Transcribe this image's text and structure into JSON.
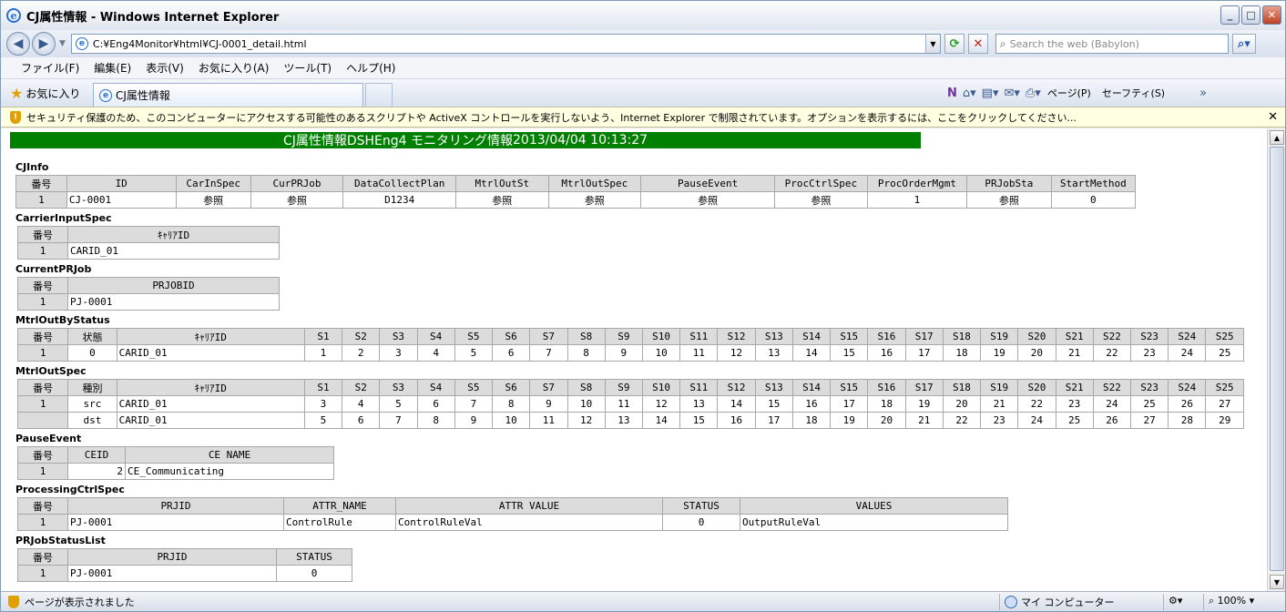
{
  "window": {
    "title": "CJ属性情報 - Windows Internet Explorer"
  },
  "address": {
    "url": "C:¥Eng4Monitor¥html¥CJ-0001_detail.html",
    "search_placeholder": "Search the web (Babylon)"
  },
  "menu": [
    "ファイル(F)",
    "編集(E)",
    "表示(V)",
    "お気に入り(A)",
    "ツール(T)",
    "ヘルプ(H)"
  ],
  "favorites": {
    "label": "お気に入り",
    "tab_title": "CJ属性情報"
  },
  "commands": {
    "page": "ページ(P)",
    "safety": "セーフティ(S)"
  },
  "security_bar": "セキュリティ保護のため、このコンピューターにアクセスする可能性のあるスクリプトや ActiveX コントロールを実行しないよう、Internet Explorer で制限されています。オプションを表示するには、ここをクリックしてください...",
  "banner": {
    "title": "CJ属性情報",
    "subtitle": "DSHEng4 モニタリング情報",
    "datetime": "2013/04/04 10:13:27"
  },
  "sections": {
    "cjinfo": {
      "title": "CJInfo",
      "headers": [
        "番号",
        "ID",
        "CarInSpec",
        "CurPRJob",
        "DataCollectPlan",
        "MtrlOutSt",
        "MtrlOutSpec",
        "PauseEvent",
        "ProcCtrlSpec",
        "ProcOrderMgmt",
        "PRJobSta",
        "StartMethod"
      ],
      "rows": [
        [
          "1",
          "CJ-0001",
          "参照",
          "参照",
          "D1234",
          "参照",
          "参照",
          "参照",
          "参照",
          "1",
          "参照",
          "0"
        ]
      ]
    },
    "carrier_input": {
      "title": "CarrierInputSpec",
      "headers": [
        "番号",
        "ｷｬﾘｱID"
      ],
      "rows": [
        [
          "1",
          "CARID_01"
        ]
      ]
    },
    "current_prjob": {
      "title": "CurrentPRJob",
      "headers": [
        "番号",
        "PRJOBID"
      ],
      "rows": [
        [
          "1",
          "PJ-0001"
        ]
      ]
    },
    "mtrl_out_status": {
      "title": "MtrlOutByStatus",
      "headers": [
        "番号",
        "状態",
        "ｷｬﾘｱID",
        "S1",
        "S2",
        "S3",
        "S4",
        "S5",
        "S6",
        "S7",
        "S8",
        "S9",
        "S10",
        "S11",
        "S12",
        "S13",
        "S14",
        "S15",
        "S16",
        "S17",
        "S18",
        "S19",
        "S20",
        "S21",
        "S22",
        "S23",
        "S24",
        "S25"
      ],
      "rows": [
        [
          "1",
          "0",
          "CARID_01",
          "1",
          "2",
          "3",
          "4",
          "5",
          "6",
          "7",
          "8",
          "9",
          "10",
          "11",
          "12",
          "13",
          "14",
          "15",
          "16",
          "17",
          "18",
          "19",
          "20",
          "21",
          "22",
          "23",
          "24",
          "25"
        ]
      ]
    },
    "mtrl_out_spec": {
      "title": "MtrlOutSpec",
      "headers": [
        "番号",
        "種別",
        "ｷｬﾘｱID",
        "S1",
        "S2",
        "S3",
        "S4",
        "S5",
        "S6",
        "S7",
        "S8",
        "S9",
        "S10",
        "S11",
        "S12",
        "S13",
        "S14",
        "S15",
        "S16",
        "S17",
        "S18",
        "S19",
        "S20",
        "S21",
        "S22",
        "S23",
        "S24",
        "S25"
      ],
      "rows": [
        [
          "1",
          "src",
          "CARID_01",
          "3",
          "4",
          "5",
          "6",
          "7",
          "8",
          "9",
          "10",
          "11",
          "12",
          "13",
          "14",
          "15",
          "16",
          "17",
          "18",
          "19",
          "20",
          "21",
          "22",
          "23",
          "24",
          "25",
          "26",
          "27"
        ],
        [
          "",
          "dst",
          "CARID_01",
          "5",
          "6",
          "7",
          "8",
          "9",
          "10",
          "11",
          "12",
          "13",
          "14",
          "15",
          "16",
          "17",
          "18",
          "19",
          "20",
          "21",
          "22",
          "23",
          "24",
          "25",
          "26",
          "27",
          "28",
          "29"
        ]
      ]
    },
    "pause_event": {
      "title": "PauseEvent",
      "headers": [
        "番号",
        "CEID",
        "CE NAME"
      ],
      "rows": [
        [
          "1",
          "2",
          "CE_Communicating"
        ]
      ]
    },
    "proc_ctrl": {
      "title": "ProcessingCtrlSpec",
      "headers": [
        "番号",
        "PRJID",
        "ATTR_NAME",
        "ATTR VALUE",
        "STATUS",
        "VALUES"
      ],
      "rows": [
        [
          "1",
          "PJ-0001",
          "ControlRule",
          "ControlRuleVal",
          "0",
          "OutputRuleVal"
        ]
      ]
    },
    "prjob_status": {
      "title": "PRJobStatusList",
      "headers": [
        "番号",
        "PRJID",
        "STATUS"
      ],
      "rows": [
        [
          "1",
          "PJ-0001",
          "0"
        ]
      ]
    }
  },
  "statusbar": {
    "text": "ページが表示されました",
    "zone": "マイ コンピューター",
    "zoom": "100%"
  }
}
